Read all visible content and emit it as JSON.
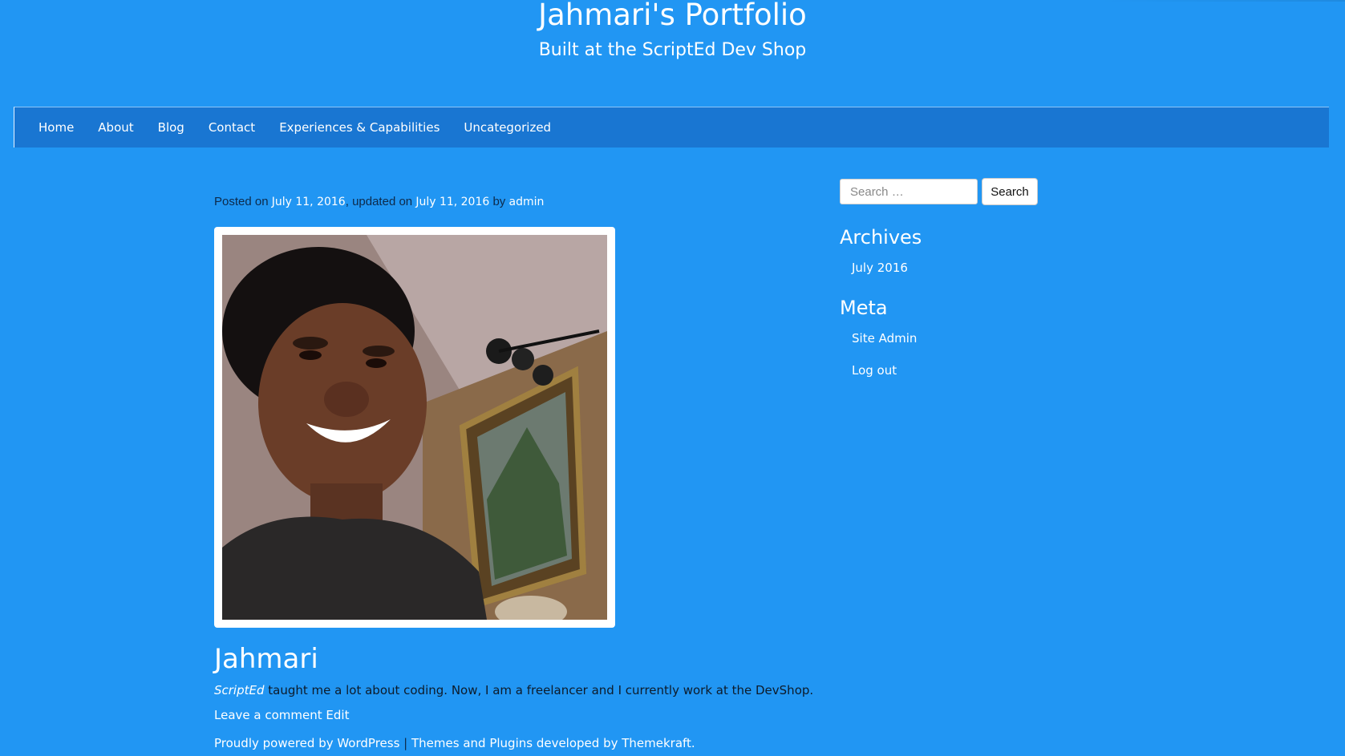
{
  "site": {
    "title": "Jahmari's Portfolio",
    "description": "Built at the ScriptEd Dev Shop"
  },
  "nav": {
    "items": [
      {
        "label": "Home"
      },
      {
        "label": "About"
      },
      {
        "label": "Blog"
      },
      {
        "label": "Contact"
      },
      {
        "label": "Experiences & Capabilities"
      },
      {
        "label": "Uncategorized"
      }
    ]
  },
  "post": {
    "meta": {
      "posted_on_label": "Posted on",
      "posted_date": "July 11, 2016",
      "updated_label": "updated on",
      "updated_date": "July 11, 2016",
      "by_label": "by",
      "author": "admin"
    },
    "image": {
      "icon": "portrait-photo"
    },
    "title": "Jahmari",
    "content": {
      "emphasis": "ScriptEd",
      "text": " taught me a lot about coding. Now, I am a freelancer and I currently work at the DevShop."
    },
    "footer": {
      "comment_link": "Leave a comment",
      "edit_link": "Edit"
    }
  },
  "sidebar": {
    "search": {
      "placeholder": "Search …",
      "button_label": "Search"
    },
    "archives": {
      "title": "Archives",
      "items": [
        {
          "label": "July 2016"
        }
      ]
    },
    "meta": {
      "title": "Meta",
      "items": [
        {
          "label": "Site Admin"
        },
        {
          "label": "Log out"
        }
      ]
    }
  },
  "footer": {
    "powered_by": "Proudly powered by WordPress",
    "separator": "|",
    "themes_credit": "Themes and Plugins developed by Themekraft."
  },
  "colors": {
    "background": "#2196F3",
    "nav_background": "#1976D2",
    "link": "#ffffff",
    "body_text": "#0d1b2a"
  }
}
